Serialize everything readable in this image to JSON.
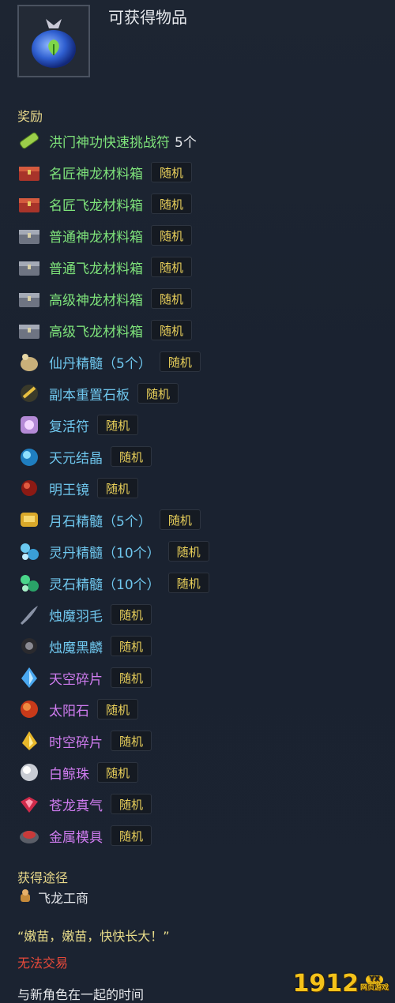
{
  "header": {
    "title": "可获得物品"
  },
  "rewards": {
    "heading": "奖励",
    "items": [
      {
        "icon": "scroll-icon",
        "name": "洪门神功快速挑战符",
        "qty": "5个",
        "tag": "",
        "color": "green"
      },
      {
        "icon": "red-chest-icon",
        "name": "名匠神龙材料箱",
        "qty": "",
        "tag": "随机",
        "color": "green"
      },
      {
        "icon": "red-chest-icon",
        "name": "名匠飞龙材料箱",
        "qty": "",
        "tag": "随机",
        "color": "green"
      },
      {
        "icon": "gray-chest-icon",
        "name": "普通神龙材料箱",
        "qty": "",
        "tag": "随机",
        "color": "green"
      },
      {
        "icon": "gray-chest-icon",
        "name": "普通飞龙材料箱",
        "qty": "",
        "tag": "随机",
        "color": "green"
      },
      {
        "icon": "gray-chest-icon",
        "name": "高级神龙材料箱",
        "qty": "",
        "tag": "随机",
        "color": "green"
      },
      {
        "icon": "gray-chest-icon",
        "name": "高级飞龙材料箱",
        "qty": "",
        "tag": "随机",
        "color": "green"
      },
      {
        "icon": "elixir-pouch-icon",
        "name": "仙丹精髓（5个）",
        "qty": "",
        "tag": "随机",
        "color": "blue"
      },
      {
        "icon": "stone-tablet-icon",
        "name": "副本重置石板",
        "qty": "",
        "tag": "随机",
        "color": "blue"
      },
      {
        "icon": "revive-charm-icon",
        "name": "复活符",
        "qty": "",
        "tag": "随机",
        "color": "blue"
      },
      {
        "icon": "blue-crystal-icon",
        "name": "天元结晶",
        "qty": "",
        "tag": "随机",
        "color": "blue"
      },
      {
        "icon": "red-orb-icon",
        "name": "明王镜",
        "qty": "",
        "tag": "随机",
        "color": "blue"
      },
      {
        "icon": "moonstone-icon",
        "name": "月石精髓（5个）",
        "qty": "",
        "tag": "随机",
        "color": "blue"
      },
      {
        "icon": "spirit-pill-icon",
        "name": "灵丹精髓（10个）",
        "qty": "",
        "tag": "随机",
        "color": "blue"
      },
      {
        "icon": "spirit-stone-icon",
        "name": "灵石精髓（10个）",
        "qty": "",
        "tag": "随机",
        "color": "blue"
      },
      {
        "icon": "feather-icon",
        "name": "烛魔羽毛",
        "qty": "",
        "tag": "随机",
        "color": "blue"
      },
      {
        "icon": "black-scale-icon",
        "name": "烛魔黑麟",
        "qty": "",
        "tag": "随机",
        "color": "blue"
      },
      {
        "icon": "sky-shard-icon",
        "name": "天空碎片",
        "qty": "",
        "tag": "随机",
        "color": "purple"
      },
      {
        "icon": "sun-stone-icon",
        "name": "太阳石",
        "qty": "",
        "tag": "随机",
        "color": "purple"
      },
      {
        "icon": "time-shard-icon",
        "name": "时空碎片",
        "qty": "",
        "tag": "随机",
        "color": "purple"
      },
      {
        "icon": "pearl-icon",
        "name": "白鲸珠",
        "qty": "",
        "tag": "随机",
        "color": "purple"
      },
      {
        "icon": "dragon-gem-icon",
        "name": "苍龙真气",
        "qty": "",
        "tag": "随机",
        "color": "purple"
      },
      {
        "icon": "metal-mold-icon",
        "name": "金属模具",
        "qty": "",
        "tag": "随机",
        "color": "purple"
      }
    ]
  },
  "source": {
    "heading": "获得途径",
    "icon": "merchant-icon",
    "name": "飞龙工商"
  },
  "flavor_text": "“嫩苗，嫩苗，快快长大！”",
  "trade_status": "无法交易",
  "footer_text": "与新角色在一起的时间",
  "watermark": {
    "number": "1912",
    "badge_top": "YX",
    "badge_bottom": "网页游戏"
  },
  "colors": {
    "green": "#7ee37a",
    "blue": "#6fc7ee",
    "purple": "#d07cf0",
    "tag": "#e8cf5a",
    "heading": "#e8d88a",
    "warning": "#e84a3a"
  }
}
